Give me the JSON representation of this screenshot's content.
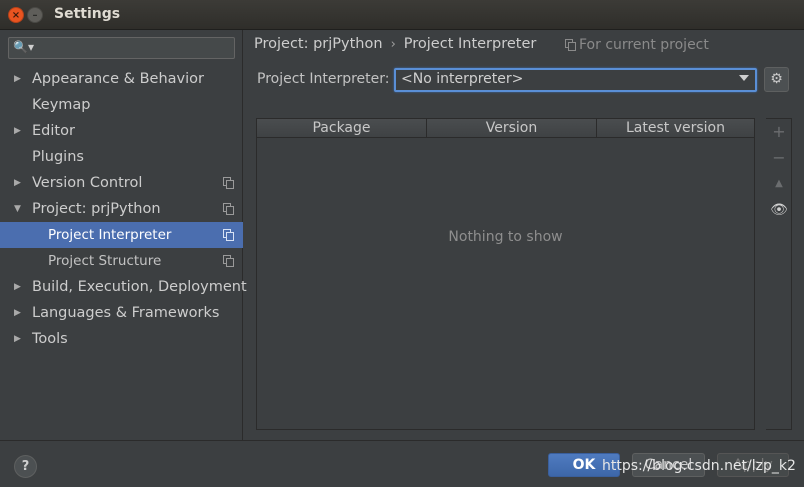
{
  "window": {
    "title": "Settings",
    "close_glyph": "×",
    "min_glyph": "–"
  },
  "sidebar": {
    "search": {
      "placeholder": "",
      "icon": "search-icon"
    },
    "items": [
      {
        "label": "Appearance & Behavior",
        "arrow": "▶",
        "copy": false,
        "level": 0
      },
      {
        "label": "Keymap",
        "arrow": "",
        "copy": false,
        "level": 0
      },
      {
        "label": "Editor",
        "arrow": "▶",
        "copy": false,
        "level": 0
      },
      {
        "label": "Plugins",
        "arrow": "",
        "copy": false,
        "level": 0
      },
      {
        "label": "Version Control",
        "arrow": "▶",
        "copy": true,
        "level": 0
      },
      {
        "label": "Project: prjPython",
        "arrow": "▼",
        "copy": true,
        "level": 0
      },
      {
        "label": "Project Interpreter",
        "arrow": "",
        "copy": true,
        "level": 1,
        "selected": true
      },
      {
        "label": "Project Structure",
        "arrow": "",
        "copy": true,
        "level": 1
      },
      {
        "label": "Build, Execution, Deployment",
        "arrow": "▶",
        "copy": false,
        "level": 0
      },
      {
        "label": "Languages & Frameworks",
        "arrow": "▶",
        "copy": false,
        "level": 0
      },
      {
        "label": "Tools",
        "arrow": "▶",
        "copy": false,
        "level": 0
      }
    ]
  },
  "main": {
    "breadcrumb": {
      "parent": "Project: prjPython",
      "separator": "›",
      "current": "Project Interpreter"
    },
    "for_current": "For current project",
    "interpreter": {
      "label": "Project Interpreter:",
      "value": "<No interpreter>",
      "gear_glyph": "⚙"
    },
    "table": {
      "columns": [
        "Package",
        "Version",
        "Latest version"
      ],
      "empty_text": "Nothing to show"
    },
    "tools": {
      "add": "+",
      "remove": "−",
      "up": "▲",
      "view": "👁"
    }
  },
  "footer": {
    "help": "?",
    "ok": "OK",
    "cancel": "Cancel",
    "apply": "Apply",
    "watermark": "https://blog.csdn.net/lzp_k2"
  },
  "colors": {
    "accent": "#4b6eaf",
    "background": "#3c3f41",
    "focus": "#5a8fd6"
  }
}
